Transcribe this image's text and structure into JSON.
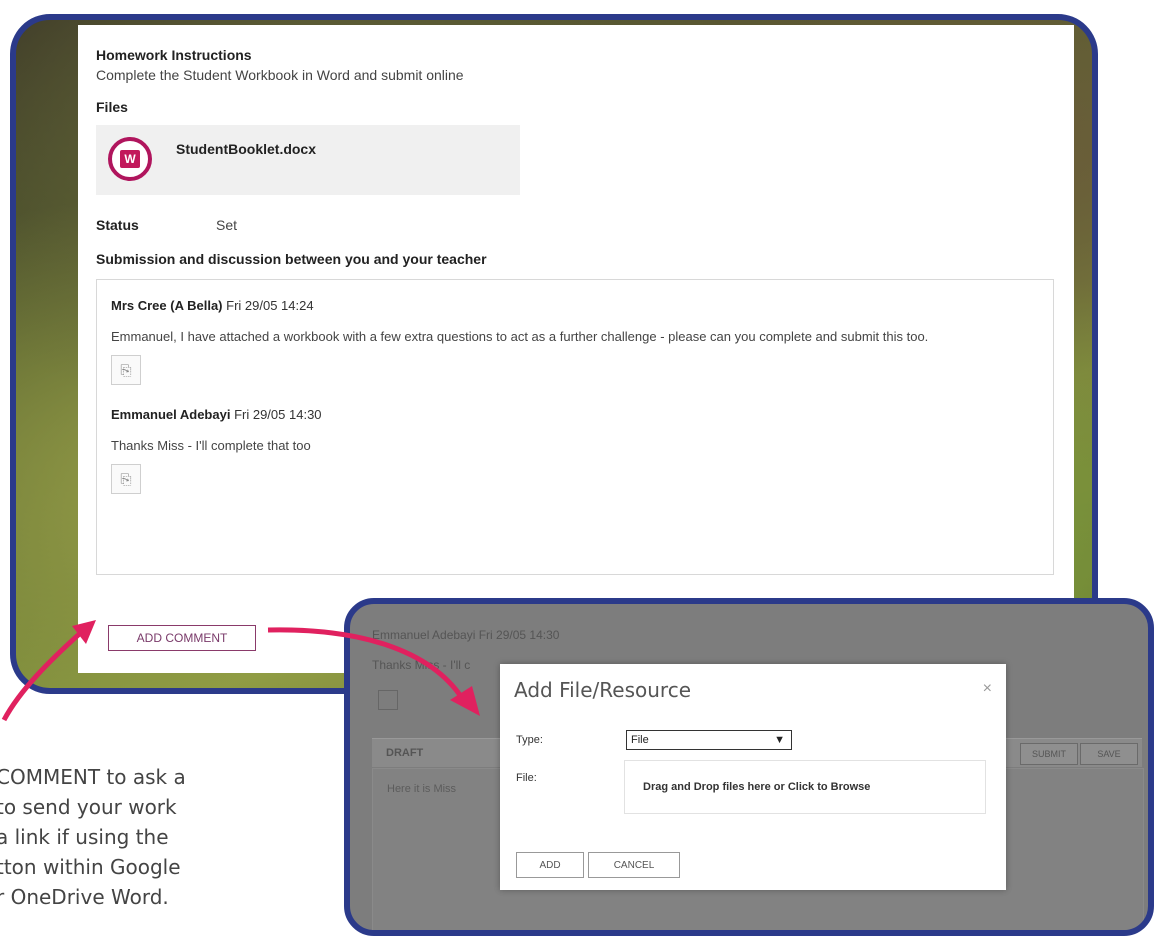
{
  "homework": {
    "title": "Homework Instructions",
    "description": "Complete the Student Workbook in Word and submit online",
    "files_label": "Files",
    "file_name": "StudentBooklet.docx",
    "status_label": "Status",
    "status_value": "Set",
    "submission_title": "Submission and discussion between you and your teacher"
  },
  "messages": [
    {
      "author": "Mrs Cree (A Bella)",
      "timestamp": "Fri 29/05 14:24",
      "text": "Emmanuel, I have attached a workbook with a few extra questions to act as a further challenge - please can you complete and submit this too."
    },
    {
      "author": "Emmanuel Adebayi",
      "timestamp": "Fri 29/05 14:30",
      "text": "Thanks Miss - I'll complete that too"
    }
  ],
  "add_comment_label": "ADD COMMENT",
  "caption_lines": [
    "COMMENT to ask a",
    "to send your work",
    "a link if using the",
    "tton within Google",
    "r OneDrive Word."
  ],
  "background": {
    "line1": "Emmanuel Adebayi Fri 29/05 14:30",
    "line2": "Thanks Miss - I'll c",
    "draft_label": "DRAFT",
    "btn1": "SUBMIT",
    "btn2": "SAVE",
    "placeholder": "Here it is Miss"
  },
  "modal": {
    "title": "Add File/Resource",
    "close_glyph": "×",
    "type_label": "Type:",
    "type_value": "File",
    "file_label": "File:",
    "drop_text": "Drag and Drop files here or Click to Browse",
    "add_label": "ADD",
    "cancel_label": "CANCEL"
  },
  "colors": {
    "frame": "#2b3a8a",
    "arrow": "#e0215f",
    "word_icon": "#c2185b"
  },
  "icons": {
    "word": "word-document-icon",
    "attachment": "attachment-icon",
    "dropdown": "chevron-down-icon"
  }
}
